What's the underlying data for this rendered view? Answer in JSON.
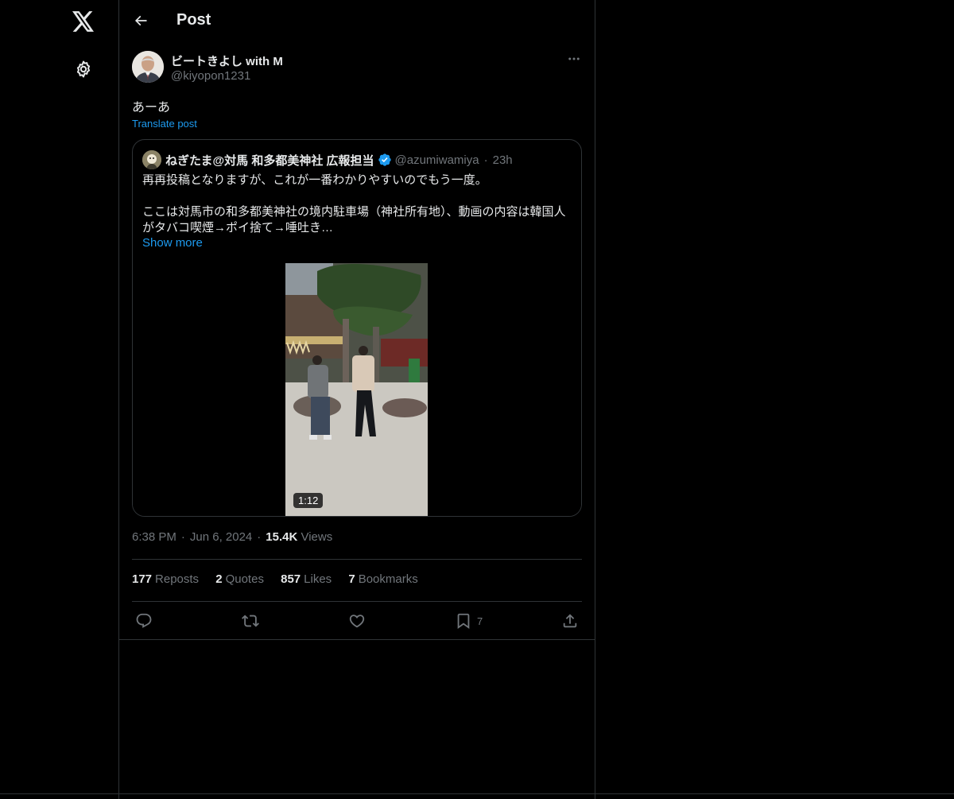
{
  "nav": {
    "logo_icon": "x-logo-icon",
    "settings_icon": "gear-icon"
  },
  "header": {
    "back_icon": "arrow-left-icon",
    "title": "Post"
  },
  "post": {
    "author": {
      "display_name": "ビートきよし with M",
      "handle": "@kiyopon1231"
    },
    "text": "あーあ",
    "translate_label": "Translate post",
    "quote": {
      "display_name": "ねぎたま@対馬 和多都美神社 広報担当",
      "verified": true,
      "handle": "@azumiwamiya",
      "time": "23h",
      "text_line1": "再再投稿となりますが、これが一番わかりやすいのでもう一度。",
      "text_line2": "ここは対馬市の和多都美神社の境内駐車場（神社所有地）、動画の内容は韓国人がタバコ喫煙→ポイ捨て→唾吐き…",
      "show_more": "Show more",
      "video_duration": "1:12"
    },
    "meta": {
      "time": "6:38 PM",
      "date": "Jun 6, 2024",
      "views_count": "15.4K",
      "views_label": "Views"
    },
    "stats": {
      "reposts_count": "177",
      "reposts_label": "Reposts",
      "quotes_count": "2",
      "quotes_label": "Quotes",
      "likes_count": "857",
      "likes_label": "Likes",
      "bookmarks_count": "7",
      "bookmarks_label": "Bookmarks"
    },
    "actions": {
      "reply_icon": "reply-icon",
      "repost_icon": "repost-icon",
      "like_icon": "heart-icon",
      "bookmark_icon": "bookmark-icon",
      "bookmark_count": "7",
      "share_icon": "share-icon"
    }
  },
  "colors": {
    "background": "#000000",
    "text_primary": "#e7e9ea",
    "text_secondary": "#71767b",
    "accent": "#1d9bf0",
    "border": "#2f3336"
  }
}
